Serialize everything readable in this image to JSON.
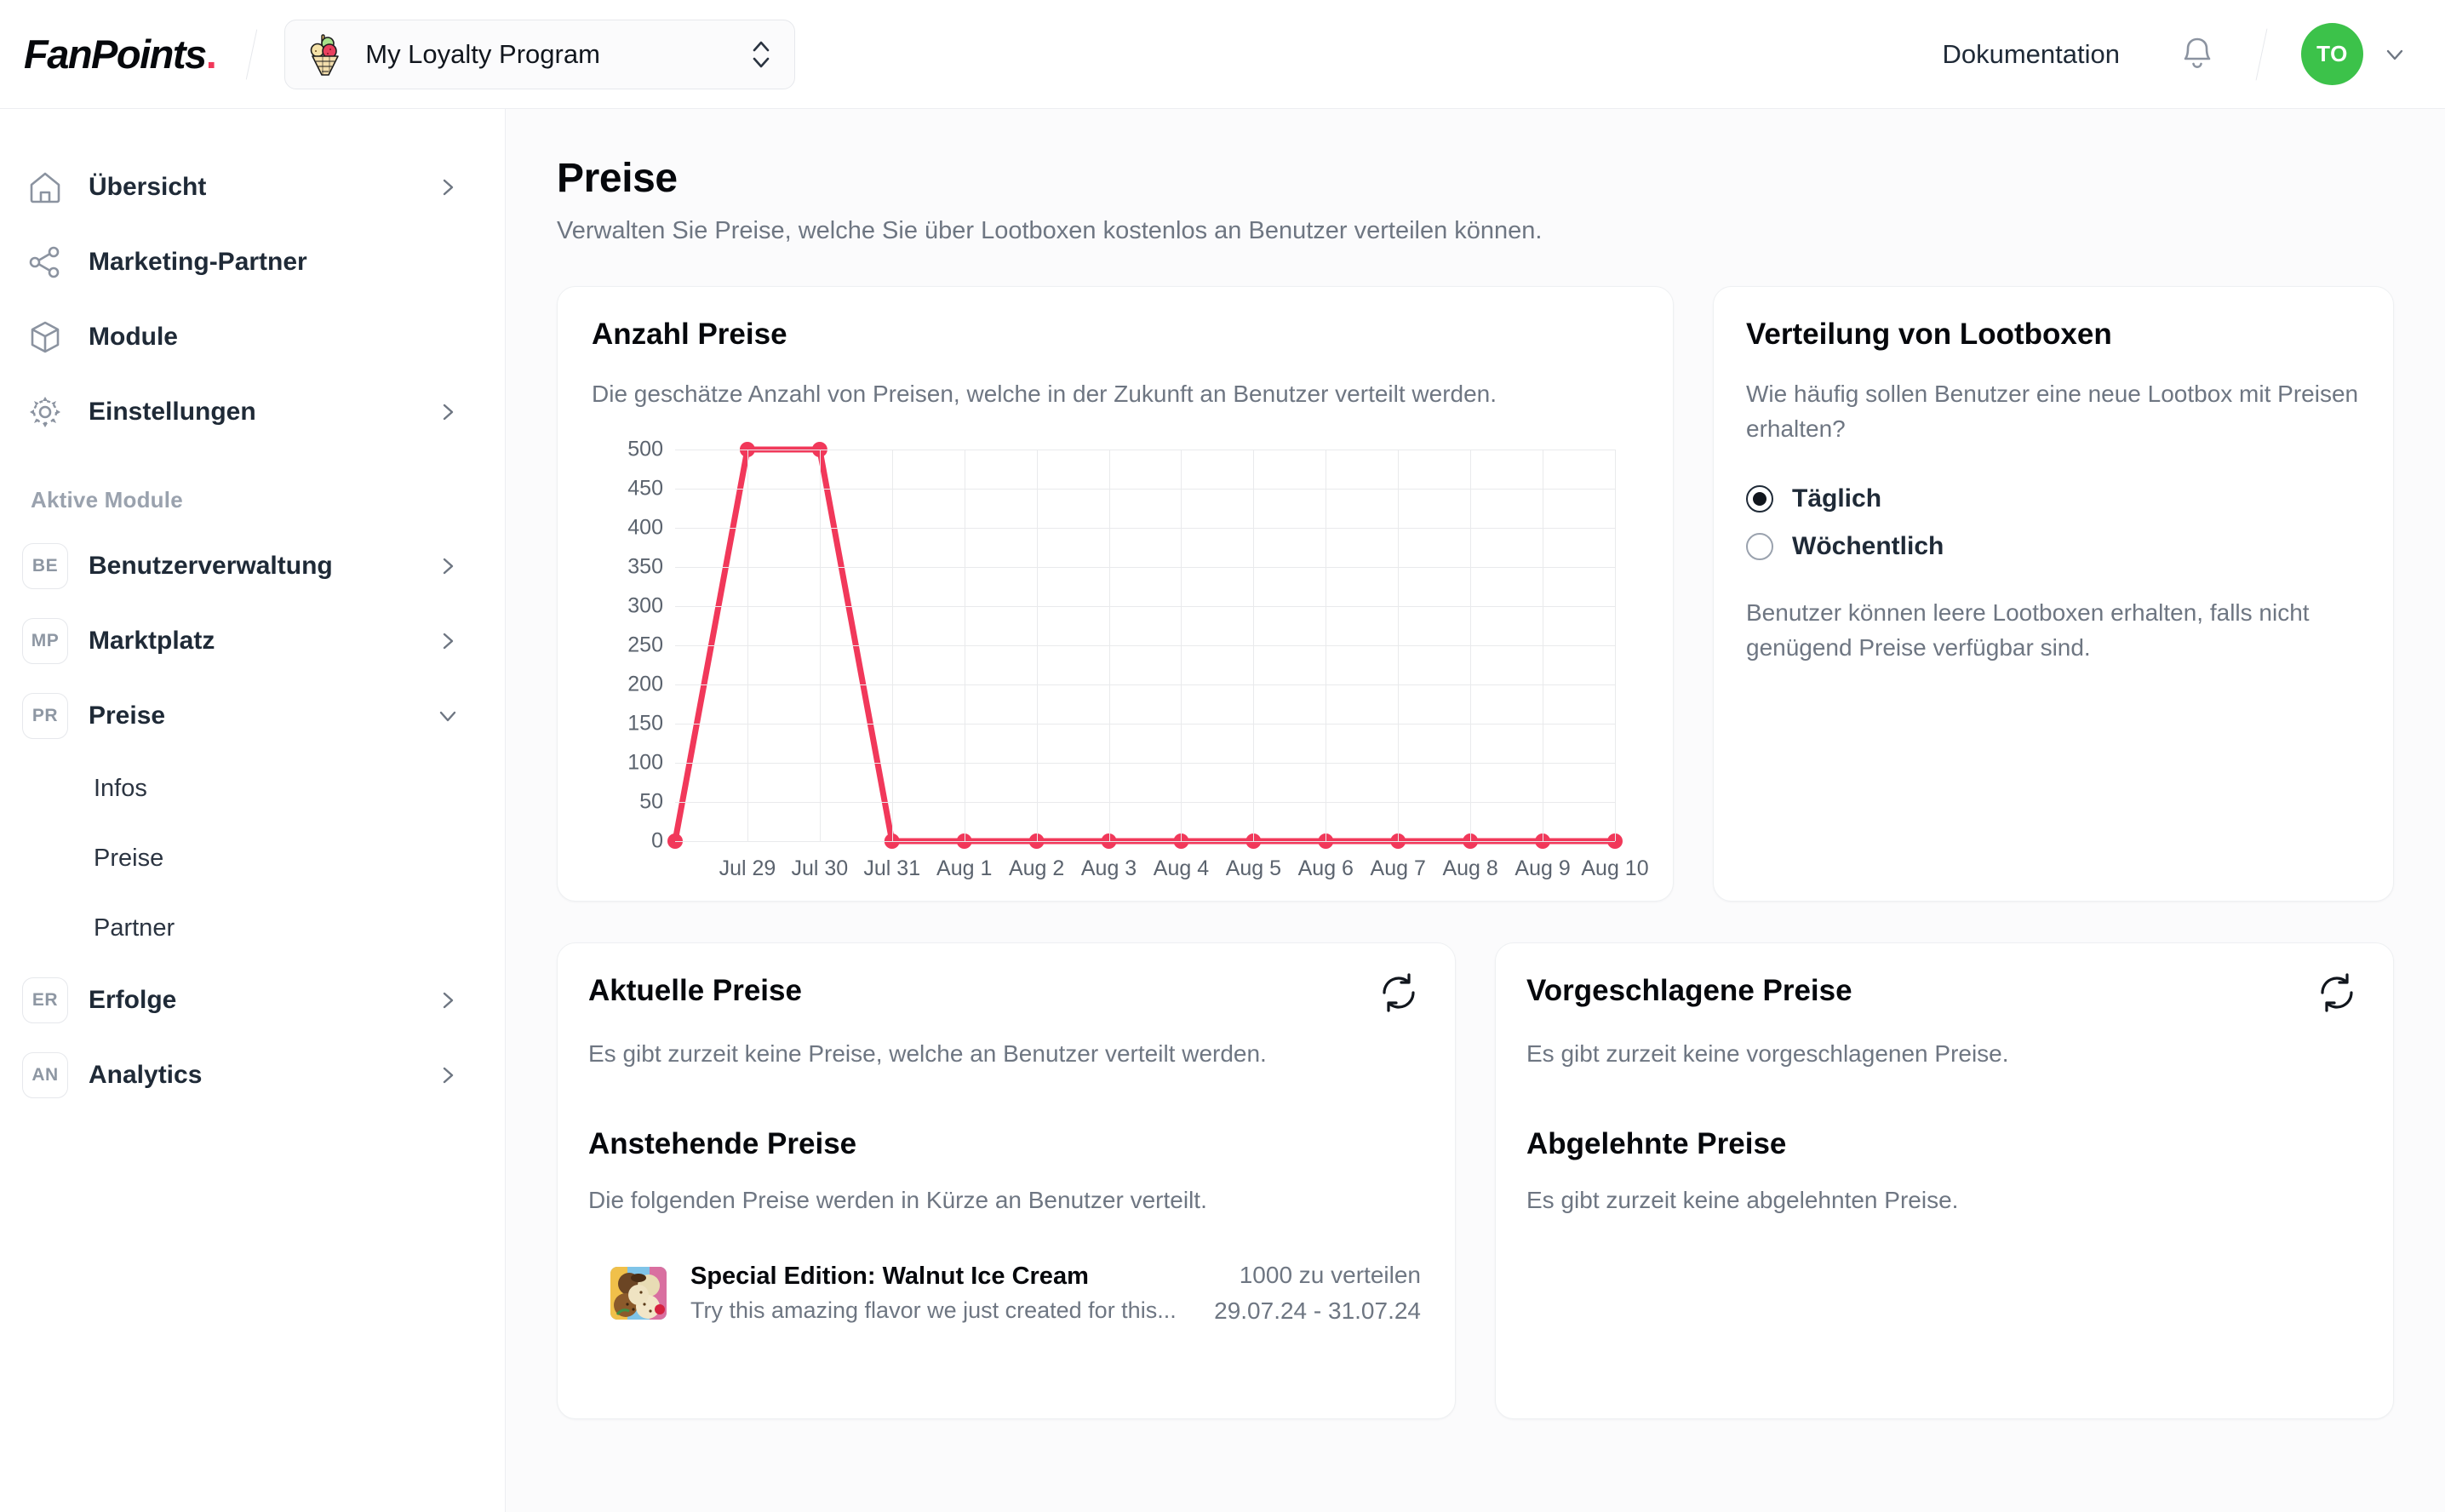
{
  "header": {
    "logo_text": "FanPoints",
    "logo_dot": ".",
    "program_name": "My Loyalty Program",
    "doc_link": "Dokumentation",
    "avatar_initials": "TO"
  },
  "sidebar": {
    "items": [
      {
        "label": "Übersicht",
        "icon": "home-icon",
        "chevron": "right"
      },
      {
        "label": "Marketing-Partner",
        "icon": "share-icon",
        "chevron": "none"
      },
      {
        "label": "Module",
        "icon": "cube-icon",
        "chevron": "none"
      },
      {
        "label": "Einstellungen",
        "icon": "gear-icon",
        "chevron": "right"
      }
    ],
    "section_title": "Aktive Module",
    "modules": [
      {
        "badge": "BE",
        "label": "Benutzerverwaltung",
        "chevron": "right"
      },
      {
        "badge": "MP",
        "label": "Marktplatz",
        "chevron": "right"
      },
      {
        "badge": "PR",
        "label": "Preise",
        "chevron": "down"
      },
      {
        "badge": "ER",
        "label": "Erfolge",
        "chevron": "right"
      },
      {
        "badge": "AN",
        "label": "Analytics",
        "chevron": "right"
      }
    ],
    "preise_subitems": [
      "Infos",
      "Preise",
      "Partner"
    ]
  },
  "page": {
    "title": "Preise",
    "subtitle": "Verwalten Sie Preise, welche Sie über Lootboxen kostenlos an Benutzer verteilen können."
  },
  "chart_card": {
    "title": "Anzahl Preise",
    "description": "Die geschätze Anzahl von Preisen, welche in der Zukunft an Benutzer verteilt werden."
  },
  "chart_data": {
    "type": "line",
    "title": "Anzahl Preise",
    "xlabel": "",
    "ylabel": "",
    "categories": [
      "",
      "Jul 29",
      "Jul 30",
      "Jul 31",
      "Aug 1",
      "Aug 2",
      "Aug 3",
      "Aug 4",
      "Aug 5",
      "Aug 6",
      "Aug 7",
      "Aug 8",
      "Aug 9",
      "Aug 10"
    ],
    "values": [
      0,
      500,
      500,
      0,
      0,
      0,
      0,
      0,
      0,
      0,
      0,
      0,
      0,
      0
    ],
    "yticks": [
      0,
      50,
      100,
      150,
      200,
      250,
      300,
      350,
      400,
      450,
      500
    ],
    "ylim": [
      0,
      500
    ],
    "grid": true,
    "legend": "none",
    "series_color": "#f1385a",
    "marker": "circle"
  },
  "lootbox_card": {
    "title": "Verteilung von Lootboxen",
    "question": "Wie häufig sollen Benutzer eine neue Lootbox mit Preisen erhalten?",
    "options": [
      {
        "label": "Täglich",
        "selected": true
      },
      {
        "label": "Wöchentlich",
        "selected": false
      }
    ],
    "hint": "Benutzer können leere Lootboxen erhalten, falls nicht genügend Preise verfügbar sind."
  },
  "current_prizes_card": {
    "title": "Aktuelle Preise",
    "empty_text": "Es gibt zurzeit keine Preise, welche an Benutzer verteilt werden.",
    "refresh_icon": "refresh-icon",
    "upcoming_title": "Anstehende Preise",
    "upcoming_description": "Die folgenden Preise werden in Kürze an Benutzer verteilt.",
    "prizes": [
      {
        "thumb_icon": "ice-cream-photo",
        "name": "Special Edition: Walnut Ice Cream",
        "description": "Try this amazing flavor we just created for this...",
        "count": "1000 zu verteilen",
        "dates": "29.07.24 - 31.07.24"
      }
    ]
  },
  "suggested_prizes_card": {
    "title": "Vorgeschlagene Preise",
    "empty_text": "Es gibt zurzeit keine vorgeschlagenen Preise.",
    "refresh_icon": "refresh-icon",
    "rejected_title": "Abgelehnte Preise",
    "rejected_empty_text": "Es gibt zurzeit keine abgelehnten Preise."
  },
  "colors": {
    "accent": "#f1385a",
    "avatar": "#3cc24a",
    "page_bg": "#fbfbfc",
    "card_bg": "#ffffff",
    "text": "#1f2a37",
    "muted": "#6e7682",
    "grid": "#e9eaec"
  }
}
